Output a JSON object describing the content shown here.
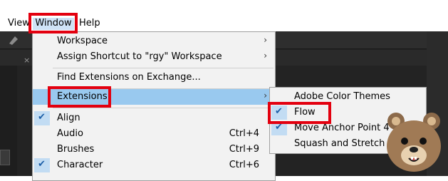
{
  "menubar": {
    "items": [
      {
        "label": "View"
      },
      {
        "label": "Window"
      },
      {
        "label": "Help"
      }
    ]
  },
  "window_menu": {
    "items": [
      {
        "label": "Workspace",
        "submenu": true
      },
      {
        "label": "Assign Shortcut to \"rgy\" Workspace",
        "submenu": true
      },
      {
        "label": "Find Extensions on Exchange..."
      },
      {
        "label": "Extensions",
        "submenu": true
      },
      {
        "label": "Align",
        "checked": true
      },
      {
        "label": "Audio",
        "shortcut": "Ctrl+4"
      },
      {
        "label": "Brushes",
        "shortcut": "Ctrl+9"
      },
      {
        "label": "Character",
        "shortcut": "Ctrl+6",
        "checked": true
      }
    ]
  },
  "extensions_submenu": {
    "items": [
      {
        "label": "Adobe Color Themes"
      },
      {
        "label": "Flow",
        "checked": true
      },
      {
        "label": "Move Anchor Point 4",
        "checked": true
      },
      {
        "label": "Squash and Stretch Free"
      }
    ]
  },
  "colors": {
    "highlight": "#99c9ef",
    "annotation_red": "#e3000f",
    "check_blue": "#1d5fa8",
    "menu_bg": "#f2f2f2",
    "app_dark": "#232323"
  },
  "icons": {
    "check": "checkmark-icon",
    "submenu_arrow": "chevron-right-icon",
    "mascot": "bear-mascot-icon"
  }
}
